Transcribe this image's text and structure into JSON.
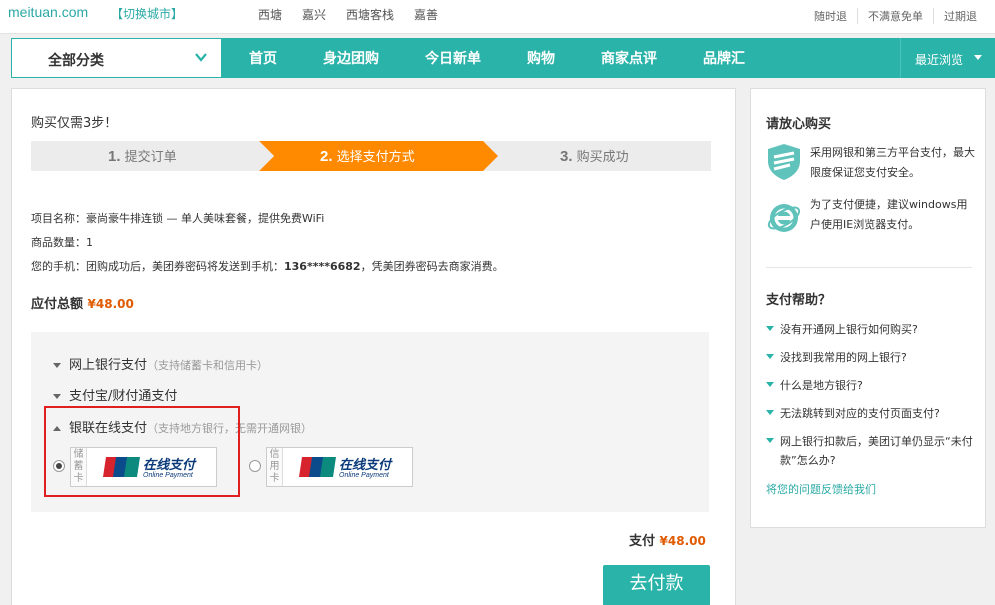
{
  "topbar": {
    "logo": "meituan.com",
    "switch_city": "【切换城市】",
    "cities": [
      "西塘",
      "嘉兴",
      "西塘客栈",
      "嘉善"
    ],
    "right_links": [
      "随时退",
      "不满意免单",
      "过期退"
    ]
  },
  "nav": {
    "category_label": "全部分类",
    "items": [
      "首页",
      "身边团购",
      "今日新单",
      "购物",
      "商家点评",
      "品牌汇"
    ],
    "recent_label": "最近浏览"
  },
  "order": {
    "steps_title": "购买仅需3步！",
    "steps": [
      {
        "num": "1.",
        "label": "提交订单"
      },
      {
        "num": "2.",
        "label": "选择支付方式"
      },
      {
        "num": "3.",
        "label": "购买成功"
      }
    ],
    "active_step": 2,
    "item_line": "项目名称：豪尚豪牛排连锁 — 单人美味套餐，提供免费WiFi",
    "qty_line": "商品数量：1",
    "phone_prefix": "您的手机：团购成功后，美团券密码将发送到手机：",
    "phone": "136****6682",
    "phone_suffix": "，凭美团券密码去商家消费。",
    "total_label": "应付总额",
    "total_amount": "¥48.00"
  },
  "payment": {
    "methods": [
      {
        "label": "网上银行支付",
        "hint": "（支持储蓄卡和信用卡）",
        "expanded": false
      },
      {
        "label": "支付宝/财付通支付",
        "hint": "",
        "expanded": false
      },
      {
        "label": "银联在线支付",
        "hint": "（支持地方银行，无需开通网银）",
        "expanded": true
      }
    ],
    "cards": [
      {
        "type": "储蓄卡",
        "chars": [
          "储",
          "蓄",
          "卡"
        ],
        "brand": "在线支付",
        "brand_sub": "Online Payment",
        "selected": true
      },
      {
        "type": "信用卡",
        "chars": [
          "信",
          "用",
          "卡"
        ],
        "brand": "在线支付",
        "brand_sub": "Online Payment",
        "selected": false
      }
    ],
    "pay_label": "支付",
    "pay_amount": "¥48.00",
    "pay_button": "去付款"
  },
  "sidebar": {
    "safe_title": "请放心购买",
    "safe_items": [
      {
        "icon": "shield-icon",
        "text": "采用网银和第三方平台支付，最大限度保证您支付安全。"
      },
      {
        "icon": "ie-browser-icon",
        "text": "为了支付便捷，建议windows用户使用IE浏览器支付。"
      }
    ],
    "help_title": "支付帮助？",
    "help_items": [
      "没有开通网上银行如何购买?",
      "没找到我常用的网上银行?",
      "什么是地方银行?",
      "无法跳转到对应的支付页面支付?",
      "网上银行扣款后，美团订单仍显示“未付款”怎么办?"
    ],
    "feedback": "将您的问题反馈给我们"
  },
  "colors": {
    "brand": "#2ab3a9",
    "active_step": "#ff8a00",
    "price": "#e05a00",
    "highlight": "#e02020"
  }
}
